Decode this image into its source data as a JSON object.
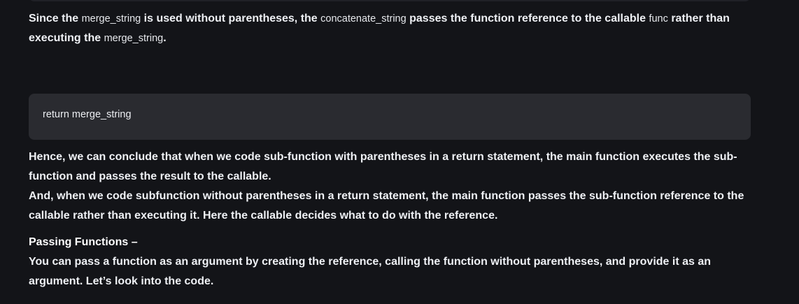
{
  "intro": {
    "t1": "Since the ",
    "c1": "merge_string",
    "t2": " is used without parentheses, the ",
    "c2": "concatenate_string",
    "t3": " passes the function reference to the callable ",
    "c3": "func",
    "t4": " rather than executing the ",
    "c4": "merge_string",
    "t5": "."
  },
  "code_block": {
    "line": "return merge_string"
  },
  "conclusion": {
    "p1": "Hence, we can conclude that when we code sub-function with parentheses in a return statement, the main function executes the sub-function and passes the result to the callable.",
    "p2": "And, when we code subfunction without parentheses in a return statement, the main function passes the sub-function reference to the callable rather than executing it. Here the callable decides what to do with the reference."
  },
  "section": {
    "heading": "Passing Functions –",
    "body": "You can pass a function as an argument by creating the reference, calling the function without parentheses, and provide it as an argument. Let’s look into the code."
  }
}
